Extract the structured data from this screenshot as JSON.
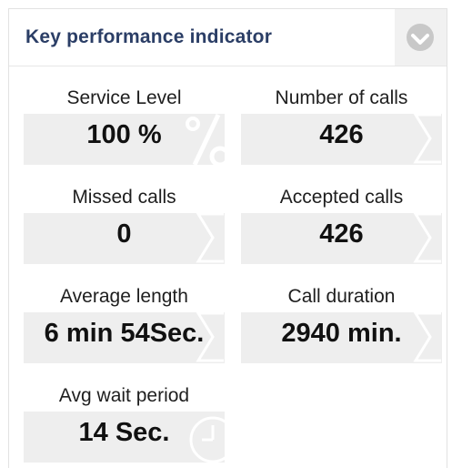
{
  "header": {
    "title": "Key performance indicator",
    "menu_icon": "chevron-down-circle-icon"
  },
  "kpis": [
    {
      "label": "Service Level",
      "value": "100 %",
      "icon": "percent-icon"
    },
    {
      "label": "Number of calls",
      "value": "426",
      "icon": "sigma-icon"
    },
    {
      "label": "Missed calls",
      "value": "0",
      "icon": "sigma-icon"
    },
    {
      "label": "Accepted calls",
      "value": "426",
      "icon": "sigma-icon"
    },
    {
      "label": "Average length",
      "value": "6 min 54Sec.",
      "icon": "sigma-icon"
    },
    {
      "label": "Call duration",
      "value": "2940 min.",
      "icon": "sigma-icon"
    },
    {
      "label": "Avg wait period",
      "value": "14 Sec.",
      "icon": "clock-icon"
    }
  ],
  "colors": {
    "title": "#2b3e66",
    "tile_background": "#eeeeee"
  }
}
